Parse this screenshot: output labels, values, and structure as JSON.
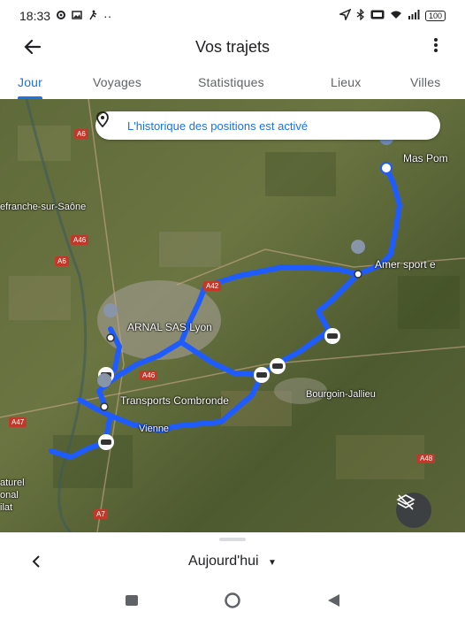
{
  "status_bar": {
    "time": "18:33",
    "left_icons": [
      "settings-icon",
      "image-icon",
      "sports-icon"
    ],
    "more": "··",
    "right_icons": [
      "location-icon",
      "bluetooth-icon",
      "volte-icon",
      "wifi-icon",
      "signal-icon"
    ],
    "battery": "100"
  },
  "app_bar": {
    "title": "Vos trajets"
  },
  "tabs": [
    {
      "label": "Jour",
      "active": true
    },
    {
      "label": "Voyages",
      "active": false
    },
    {
      "label": "Statistiques",
      "active": false
    },
    {
      "label": "Lieux",
      "active": false
    },
    {
      "label": "Villes",
      "active": false
    }
  ],
  "map": {
    "banner_text": "L'historique des positions est activé",
    "places": [
      {
        "name": "Mas Pom"
      },
      {
        "name": "Amer sport e"
      },
      {
        "name": "ARNAL SAS Lyon"
      },
      {
        "name": "Transports Combronde"
      }
    ],
    "towns": [
      "efranche-sur-Saône",
      "Bourgoin-Jallieu",
      "Vienne"
    ],
    "roads": [
      "A6",
      "A46",
      "A6",
      "A42",
      "A46",
      "A47",
      "A48",
      "A7"
    ],
    "park_label": [
      "aturel",
      "onal",
      "ilat"
    ],
    "route_color": "#1f5cff"
  },
  "bottom_sheet": {
    "day_label": "Aujourd'hui"
  },
  "colors": {
    "accent": "#1a73e8",
    "text": "#202124"
  }
}
